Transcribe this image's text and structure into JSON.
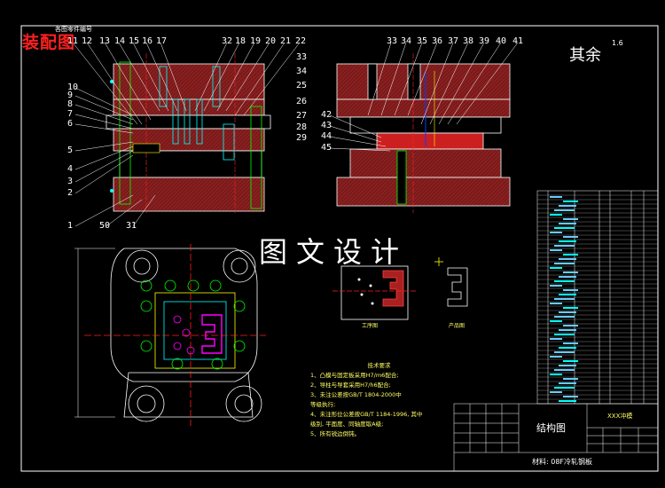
{
  "stamp": "装配图",
  "watermark": "图文设计",
  "roughness": {
    "text": "其余",
    "value": "1.6"
  },
  "top_note": "各图零件编号",
  "callouts_left": [
    "11",
    "12",
    "13",
    "14",
    "15",
    "16",
    "17",
    "32",
    "18",
    "19",
    "20",
    "21",
    "22",
    "33",
    "34",
    "25",
    "26",
    "27",
    "28",
    "29",
    "10",
    "9",
    "8",
    "7",
    "6",
    "5",
    "4",
    "3",
    "2",
    "1",
    "50",
    "31"
  ],
  "callouts_right": [
    "33",
    "34",
    "35",
    "36",
    "37",
    "38",
    "39",
    "40",
    "41",
    "42",
    "43",
    "44",
    "45"
  ],
  "captions": {
    "process": "工序图",
    "part": "产品图"
  },
  "tech_requirements": {
    "title": "技术要求",
    "items": [
      "1、凸模与固定板采用H7/m6配合;",
      "2、导柱与导套采用H7/h6配合;",
      "3、未注公差按GB/T 1804-2000中",
      "   等级执行;",
      "4、未注形位公差按GB/T 1184-1996, 其中",
      "   级别, 平面度、同轴度取A级;",
      "5、所有锐边倒钝。"
    ]
  },
  "title_block": {
    "drawing_name": "结构图",
    "material": "材料: 08F冷轧钢板",
    "drawing_no": "XXX冲模"
  },
  "colors": {
    "red": "#ff2020",
    "cyan": "#00ffff",
    "green": "#00ff00",
    "yellow": "#ffff00",
    "hatch": "#8b1a1a"
  }
}
